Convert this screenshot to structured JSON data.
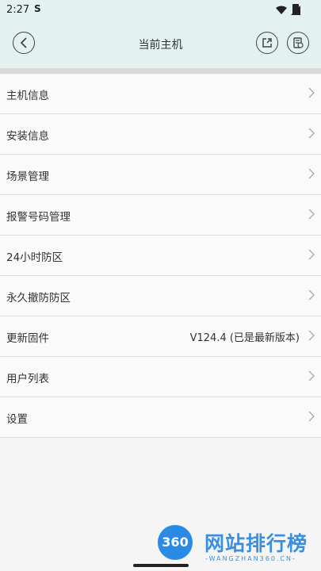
{
  "status_bar": {
    "time": "2:27",
    "notification_icon": "s-icon",
    "indicators": [
      "wifi-icon",
      "signal-icon",
      "battery-icon"
    ]
  },
  "header": {
    "title": "当前主机",
    "back_icon": "chevron-left-icon",
    "share_icon": "share-icon",
    "log_icon": "document-icon"
  },
  "menu": {
    "items": [
      {
        "label": "主机信息",
        "value": ""
      },
      {
        "label": "安装信息",
        "value": ""
      },
      {
        "label": "场景管理",
        "value": ""
      },
      {
        "label": "报警号码管理",
        "value": ""
      },
      {
        "label": "24小时防区",
        "value": ""
      },
      {
        "label": "永久撤防防区",
        "value": ""
      },
      {
        "label": "更新固件",
        "value": "V124.4 (已是最新版本)"
      },
      {
        "label": "用户列表",
        "value": ""
      },
      {
        "label": "设置",
        "value": ""
      }
    ]
  },
  "watermark": {
    "logo_text": "360",
    "title": "网站排行榜",
    "subtitle": "-WANGZHAN360.CN-"
  },
  "colors": {
    "header_bg": "#e3f1f1",
    "list_bg": "#fafafa",
    "divider": "#dcdcdc",
    "watermark_blue": "#2a8be6"
  }
}
